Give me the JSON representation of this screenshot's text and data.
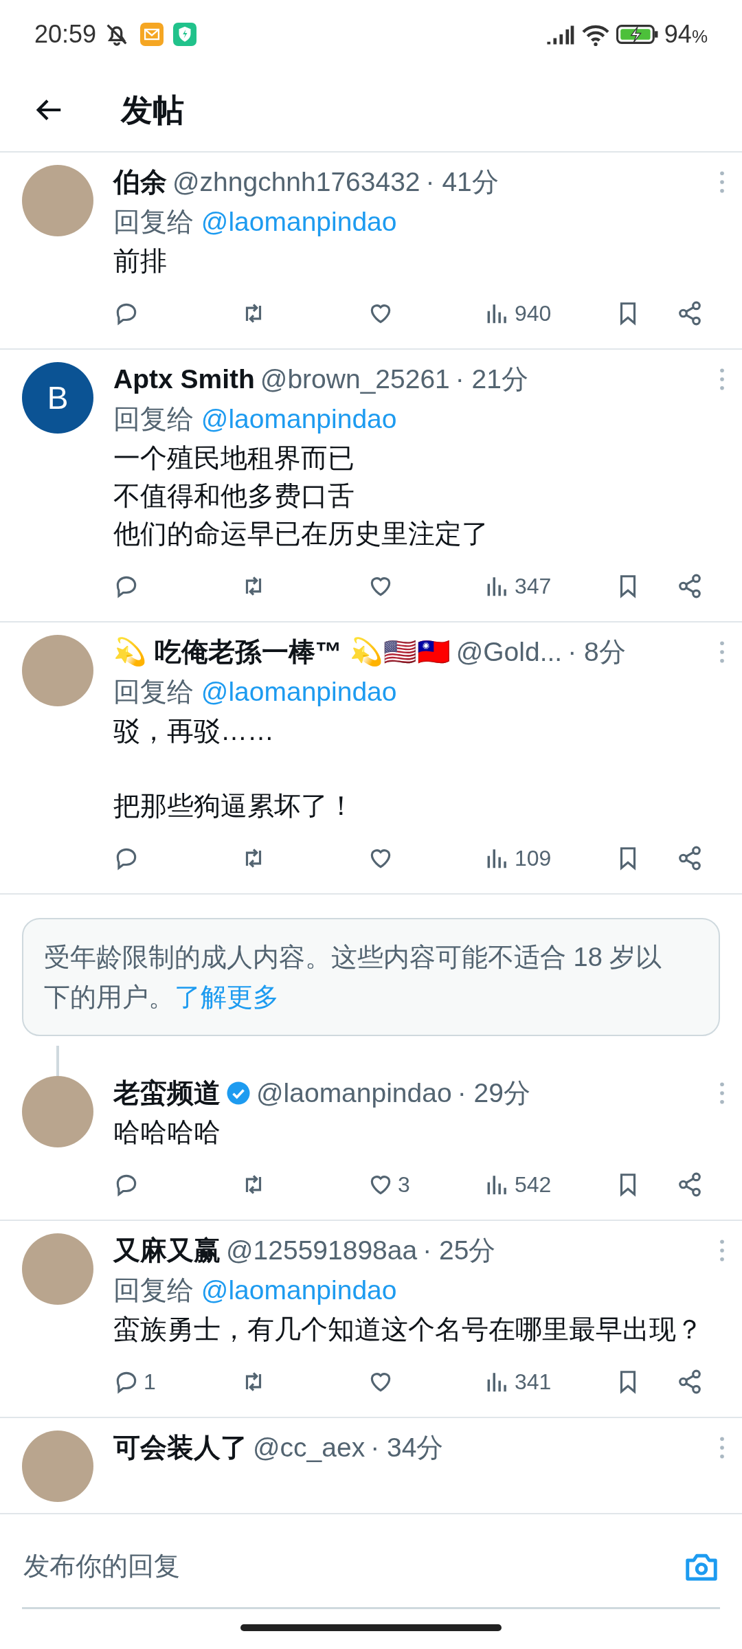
{
  "status_bar": {
    "time": "20:59",
    "battery": "94",
    "battery_unit": "%"
  },
  "header": {
    "title": "发帖"
  },
  "feed": [
    {
      "kind": "post",
      "avatar": {
        "kind": "photo"
      },
      "name": "伯余",
      "handle": "@zhngchnh1763432",
      "time": "· 41分",
      "reply_label": "回复给",
      "reply_to": "@laomanpindao",
      "paragraphs": [
        [
          "前排"
        ]
      ],
      "actions": [
        {
          "kind": "reply"
        },
        {
          "kind": "repost"
        },
        {
          "kind": "like"
        },
        {
          "kind": "views",
          "count": "940"
        },
        {
          "kind": "bookmark"
        },
        {
          "kind": "share"
        }
      ]
    },
    {
      "kind": "post",
      "avatar": {
        "kind": "letter",
        "letter": "B",
        "color": "#0b5394"
      },
      "name": "Aptx Smith",
      "handle": "@brown_25261",
      "time": "· 21分",
      "reply_label": "回复给",
      "reply_to": "@laomanpindao",
      "paragraphs": [
        [
          "一个殖民地租界而已",
          "不值得和他多费口舌",
          "他们的命运早已在历史里注定了"
        ]
      ],
      "actions": [
        {
          "kind": "reply"
        },
        {
          "kind": "repost"
        },
        {
          "kind": "like"
        },
        {
          "kind": "views",
          "count": "347"
        },
        {
          "kind": "bookmark"
        },
        {
          "kind": "share"
        }
      ]
    },
    {
      "kind": "post",
      "avatar": {
        "kind": "photo"
      },
      "name": "💫 吃俺老孫一棒™ 💫🇺🇸🇹🇼",
      "handle": "@Gold...",
      "time": "· 8分",
      "reply_label": "回复给",
      "reply_to": "@laomanpindao",
      "paragraphs": [
        [
          "驳，再驳……"
        ],
        [
          "把那些狗逼累坏了！"
        ]
      ],
      "actions": [
        {
          "kind": "reply"
        },
        {
          "kind": "repost"
        },
        {
          "kind": "like"
        },
        {
          "kind": "views",
          "count": "109"
        },
        {
          "kind": "bookmark"
        },
        {
          "kind": "share"
        }
      ]
    },
    {
      "kind": "notice",
      "text": "受年龄限制的成人内容。这些内容可能不适合 18 岁以下的用户。",
      "link": "了解更多"
    },
    {
      "kind": "post",
      "avatar": {
        "kind": "photo"
      },
      "name": "老蛮频道",
      "verified": true,
      "handle": "@laomanpindao",
      "time": "· 29分",
      "paragraphs": [
        [
          "哈哈哈哈"
        ]
      ],
      "thread_top": true,
      "actions": [
        {
          "kind": "reply"
        },
        {
          "kind": "repost"
        },
        {
          "kind": "like",
          "count": "3"
        },
        {
          "kind": "views",
          "count": "542"
        },
        {
          "kind": "bookmark"
        },
        {
          "kind": "share"
        }
      ]
    },
    {
      "kind": "post",
      "avatar": {
        "kind": "photo"
      },
      "name": "又麻又赢",
      "handle": "@125591898aa",
      "time": "· 25分",
      "reply_label": "回复给",
      "reply_to": "@laomanpindao",
      "paragraphs": [
        [
          "蛮族勇士，有几个知道这个名号在哪里最早出现？"
        ]
      ],
      "actions": [
        {
          "kind": "reply",
          "count": "1"
        },
        {
          "kind": "repost"
        },
        {
          "kind": "like"
        },
        {
          "kind": "views",
          "count": "341"
        },
        {
          "kind": "bookmark"
        },
        {
          "kind": "share"
        }
      ]
    },
    {
      "kind": "post",
      "avatar": {
        "kind": "photo"
      },
      "name": "可会装人了",
      "handle": "@cc_aex",
      "time": "· 34分"
    }
  ],
  "reply_bar": {
    "placeholder": "发布你的回复"
  }
}
